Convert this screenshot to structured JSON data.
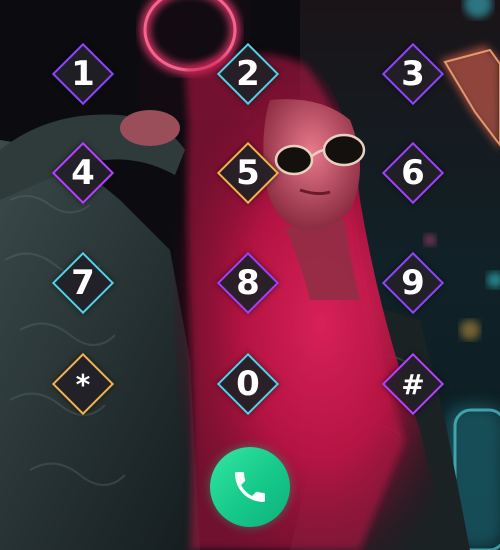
{
  "keypad": {
    "keys": [
      {
        "label": "1",
        "accent": "#8e44ff"
      },
      {
        "label": "2",
        "accent": "#4fd1e6"
      },
      {
        "label": "3",
        "accent": "#8e44ff"
      },
      {
        "label": "4",
        "accent": "#b640ff"
      },
      {
        "label": "5",
        "accent": "#f2b24a"
      },
      {
        "label": "6",
        "accent": "#a040ff"
      },
      {
        "label": "7",
        "accent": "#4fd1e6"
      },
      {
        "label": "8",
        "accent": "#a040ff"
      },
      {
        "label": "9",
        "accent": "#8e44ff"
      },
      {
        "label": "*",
        "accent": "#f2b24a"
      },
      {
        "label": "0",
        "accent": "#4fd1e6"
      },
      {
        "label": "#",
        "accent": "#b640ff"
      }
    ]
  },
  "call_button": {
    "icon": "phone-icon",
    "color": "#1fd190"
  }
}
